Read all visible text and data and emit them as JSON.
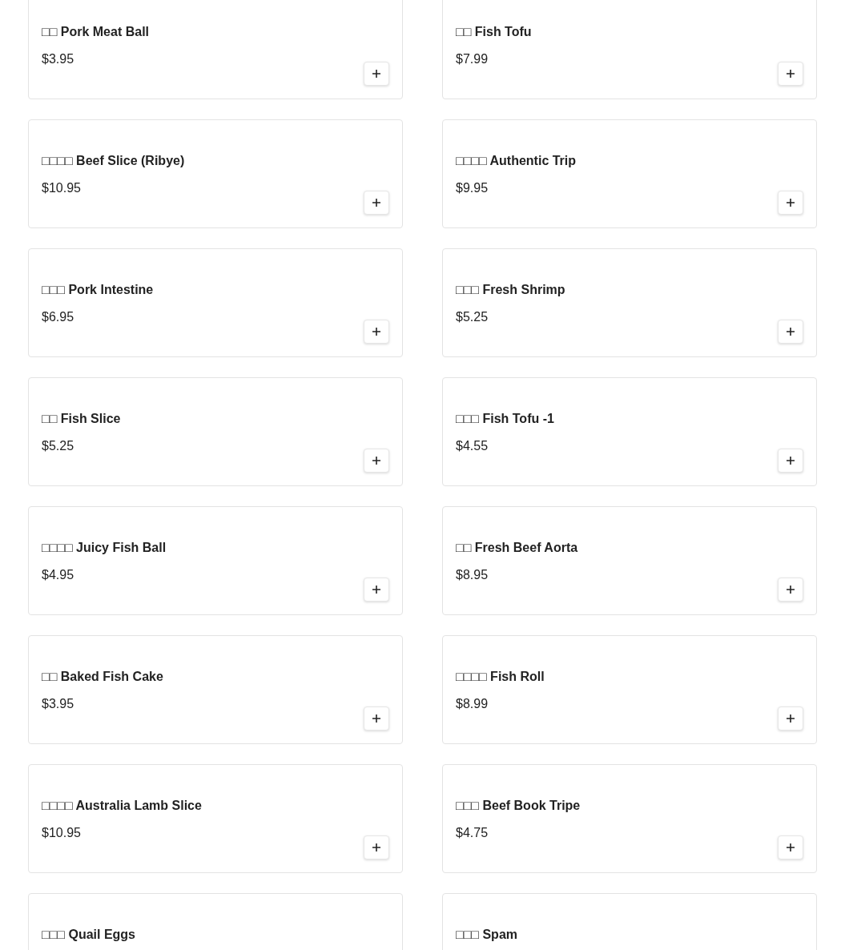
{
  "items": [
    {
      "name": "□□ Pork Meat Ball",
      "price": "$3.95"
    },
    {
      "name": "□□ Fish Tofu",
      "price": "$7.99"
    },
    {
      "name": "□□□□ Beef Slice (Ribye)",
      "price": "$10.95"
    },
    {
      "name": "□□□□ Authentic Trip",
      "price": "$9.95"
    },
    {
      "name": "□□□ Pork Intestine",
      "price": "$6.95"
    },
    {
      "name": "□□□ Fresh Shrimp",
      "price": "$5.25"
    },
    {
      "name": "□□ Fish Slice",
      "price": "$5.25"
    },
    {
      "name": "□□□ Fish Tofu -1",
      "price": "$4.55"
    },
    {
      "name": "□□□□ Juicy Fish Ball",
      "price": "$4.95"
    },
    {
      "name": "□□ Fresh Beef Aorta",
      "price": "$8.95"
    },
    {
      "name": "□□ Baked Fish Cake",
      "price": "$3.95"
    },
    {
      "name": "□□□□ Fish Roll",
      "price": "$8.99"
    },
    {
      "name": "□□□□ Australia Lamb Slice",
      "price": "$10.95"
    },
    {
      "name": "□□□ Beef Book Tripe",
      "price": "$4.75"
    },
    {
      "name": "□□□ Quail Eggs"
    },
    {
      "name": "□□□ Spam"
    }
  ]
}
